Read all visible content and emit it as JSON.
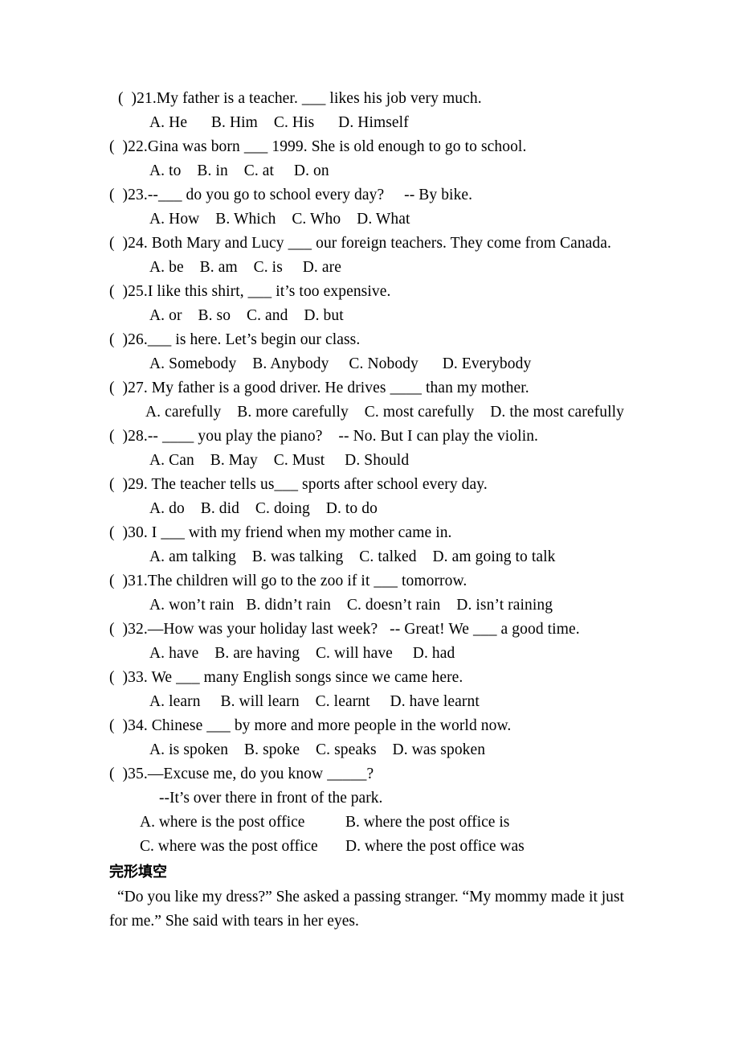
{
  "document": {
    "questions": [
      {
        "marker": "(  )",
        "number": "21.",
        "stem": "My father is a teacher. ___ likes his job very much.",
        "options": "A. He      B. Him    C. His      D. Himself"
      },
      {
        "marker": "(  )",
        "number": "22.",
        "stem": "Gina was born ___ 1999. She is old enough to go to school.",
        "options": "A. to    B. in    C. at     D. on"
      },
      {
        "marker": "(  )",
        "number": "23.",
        "stem": "--___ do you go to school every day?     -- By bike.",
        "options": "A. How    B. Which    C. Who    D. What"
      },
      {
        "marker": "(  )",
        "number": "24.",
        "stem": " Both Mary and Lucy ___ our foreign teachers. They come from Canada.",
        "options": "A. be    B. am    C. is     D. are"
      },
      {
        "marker": "(  )",
        "number": "25.",
        "stem": "I like this shirt, ___ it’s too expensive.",
        "options": "A. or    B. so    C. and    D. but"
      },
      {
        "marker": "(  )",
        "number": "26.",
        "stem": "___ is here. Let’s begin our class.",
        "options": "A. Somebody    B. Anybody     C. Nobody      D. Everybody"
      },
      {
        "marker": "(  )",
        "number": "27.",
        "stem": " My father is a good driver. He drives ____ than my mother.",
        "options": "A. carefully    B. more carefully    C. most carefully    D. the most carefully"
      },
      {
        "marker": "(  )",
        "number": "28.",
        "stem": "-- ____ you play the piano?    -- No. But I can play the violin.",
        "options": "A. Can    B. May    C. Must     D. Should"
      },
      {
        "marker": "(  )",
        "number": "29.",
        "stem": " The teacher tells us___ sports after school every day.",
        "options": "A. do    B. did    C. doing    D. to do"
      },
      {
        "marker": "(  )",
        "number": "30.",
        "stem": " I ___ with my friend when my mother came in.",
        "options": "A. am talking    B. was talking    C. talked    D. am going to talk"
      },
      {
        "marker": "(  )",
        "number": "31.",
        "stem": "The children will go to the zoo if it ___ tomorrow.",
        "options": "A. won’t rain   B. didn’t rain    C. doesn’t rain    D. isn’t raining"
      },
      {
        "marker": "(  )",
        "number": "32.",
        "stem": "—How was your holiday last week?   -- Great! We ___ a good time.",
        "options": "A. have    B. are having    C. will have     D. had"
      },
      {
        "marker": "(  )",
        "number": "33.",
        "stem": " We ___ many English songs since we came here.",
        "options": "A. learn     B. will learn    C. learnt     D. have learnt"
      },
      {
        "marker": "(  )",
        "number": "34.",
        "stem": " Chinese ___ by more and more people in the world now.",
        "options": "A. is spoken    B. spoke    C. speaks    D. was spoken"
      }
    ],
    "question35": {
      "marker": "(  )",
      "number": "35.",
      "stem": "—Excuse me, do you know _____?",
      "answer_line": "--It’s over there in front of the park.",
      "option_a": "A. where is the post office",
      "option_b": "B. where the post office is",
      "option_c": "C. where was the post office",
      "option_d": "D. where the post office was"
    },
    "section": {
      "heading": "完形填空",
      "passage": "“Do you like my dress?” She asked a passing stranger. “My mommy made it just for me.” She said with tears in her eyes."
    }
  }
}
